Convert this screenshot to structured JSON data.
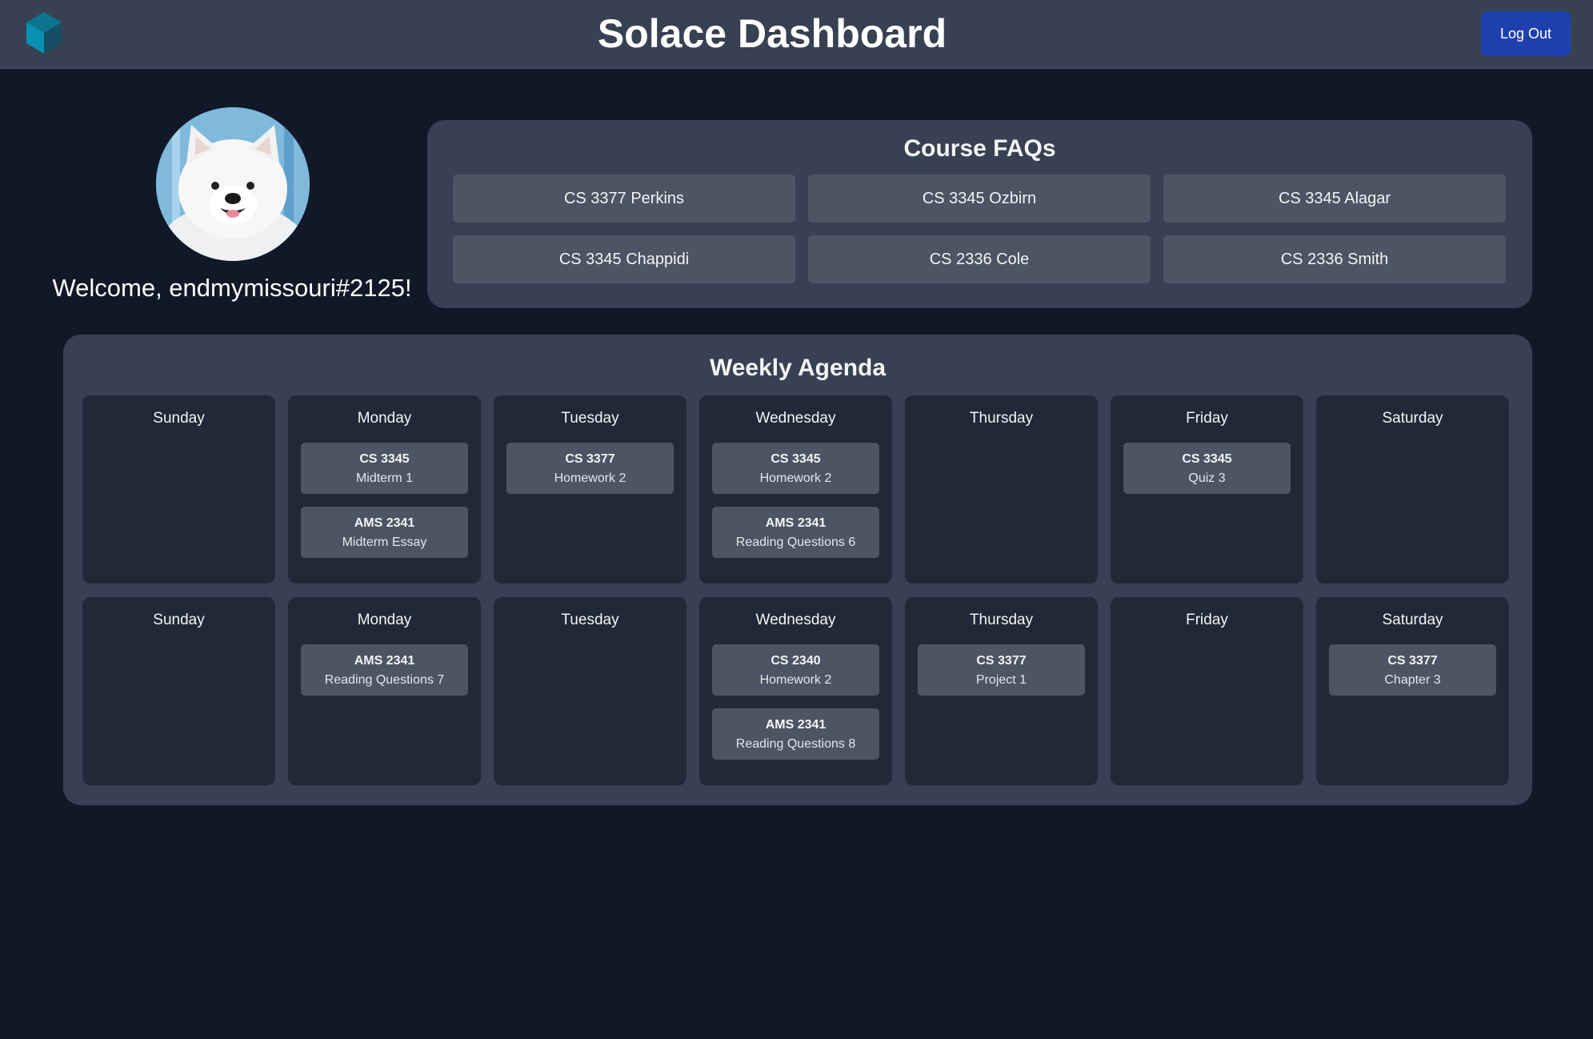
{
  "header": {
    "title": "Solace Dashboard",
    "logout_label": "Log Out",
    "logo_icon": "hexagon-logo-icon"
  },
  "profile": {
    "avatar_icon": "samoyed-avatar",
    "welcome_text": "Welcome, endmymissouri#2125!"
  },
  "faqs": {
    "title": "Course FAQs",
    "items": [
      "CS 3377 Perkins",
      "CS 3345 Ozbirn",
      "CS 3345 Alagar",
      "CS 3345 Chappidi",
      "CS 2336 Cole",
      "CS 2336 Smith"
    ]
  },
  "agenda": {
    "title": "Weekly Agenda",
    "weeks": [
      [
        {
          "day": "Sunday",
          "tasks": []
        },
        {
          "day": "Monday",
          "tasks": [
            {
              "course": "CS 3345",
              "name": "Midterm 1"
            },
            {
              "course": "AMS 2341",
              "name": "Midterm Essay"
            }
          ]
        },
        {
          "day": "Tuesday",
          "tasks": [
            {
              "course": "CS 3377",
              "name": "Homework 2"
            }
          ]
        },
        {
          "day": "Wednesday",
          "tasks": [
            {
              "course": "CS 3345",
              "name": "Homework 2"
            },
            {
              "course": "AMS 2341",
              "name": "Reading Questions 6"
            }
          ]
        },
        {
          "day": "Thursday",
          "tasks": []
        },
        {
          "day": "Friday",
          "tasks": [
            {
              "course": "CS 3345",
              "name": "Quiz 3"
            }
          ]
        },
        {
          "day": "Saturday",
          "tasks": []
        }
      ],
      [
        {
          "day": "Sunday",
          "tasks": []
        },
        {
          "day": "Monday",
          "tasks": [
            {
              "course": "AMS 2341",
              "name": "Reading Questions 7"
            }
          ]
        },
        {
          "day": "Tuesday",
          "tasks": []
        },
        {
          "day": "Wednesday",
          "tasks": [
            {
              "course": "CS 2340",
              "name": "Homework 2"
            },
            {
              "course": "AMS 2341",
              "name": "Reading Questions 8"
            }
          ]
        },
        {
          "day": "Thursday",
          "tasks": [
            {
              "course": "CS 3377",
              "name": "Project 1"
            }
          ]
        },
        {
          "day": "Friday",
          "tasks": []
        },
        {
          "day": "Saturday",
          "tasks": [
            {
              "course": "CS 3377",
              "name": "Chapter 3"
            }
          ]
        }
      ]
    ]
  },
  "colors": {
    "background": "#111827",
    "header": "#374151",
    "panel": "#374151",
    "day_card": "#1f2937",
    "item": "#4b5563",
    "logout_button": "#1e40af",
    "logo": "#0e7490"
  }
}
